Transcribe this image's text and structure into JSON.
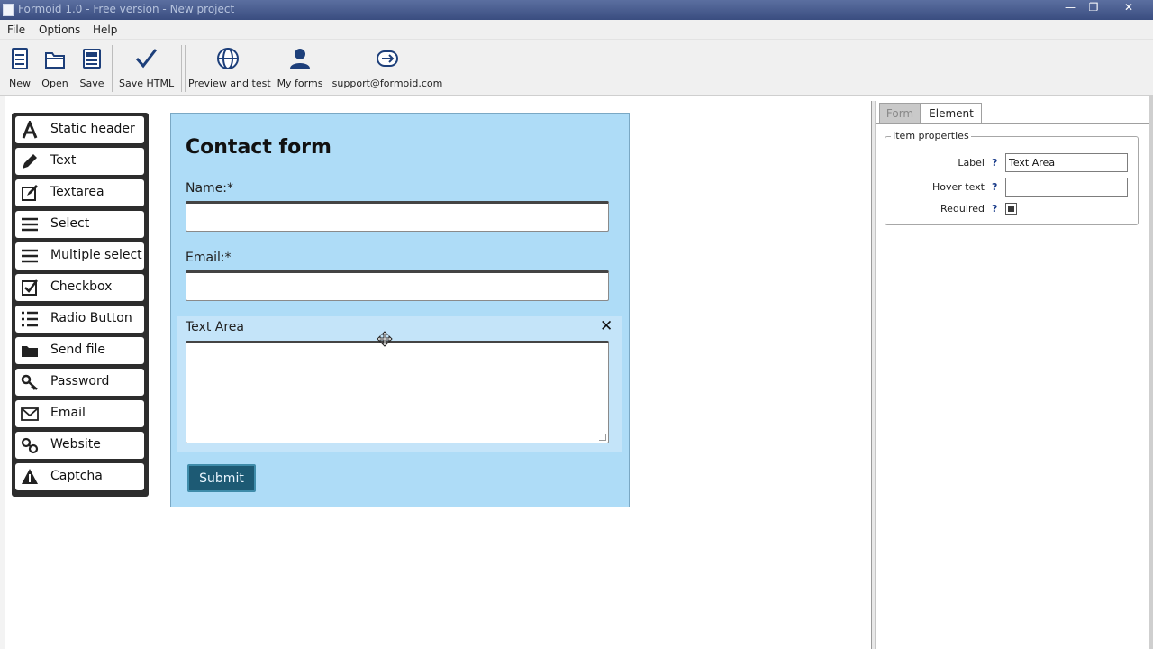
{
  "window": {
    "title": "Formoid 1.0 - Free version - New project",
    "controls": [
      "minimize-icon",
      "restore-icon",
      "close-icon"
    ]
  },
  "menu": {
    "items": [
      "File",
      "Options",
      "Help"
    ]
  },
  "toolbar": {
    "buttons": [
      {
        "label": "New",
        "icon": "new-document-icon"
      },
      {
        "label": "Open",
        "icon": "folder-open-icon"
      },
      {
        "label": "Save",
        "icon": "save-icon"
      },
      {
        "label": "Save HTML",
        "icon": "checkmark-icon"
      },
      {
        "label": "Preview and test",
        "icon": "globe-icon"
      },
      {
        "label": "My forms",
        "icon": "user-icon"
      },
      {
        "label": "support@formoid.com",
        "icon": "support-icon"
      }
    ]
  },
  "palette": {
    "items": [
      {
        "label": "Static header",
        "icon": "letter-a-icon"
      },
      {
        "label": "Text",
        "icon": "pencil-icon"
      },
      {
        "label": "Textarea",
        "icon": "edit-box-icon"
      },
      {
        "label": "Select",
        "icon": "lines-icon"
      },
      {
        "label": "Multiple select",
        "icon": "lines-icon"
      },
      {
        "label": "Checkbox",
        "icon": "checkbox-icon"
      },
      {
        "label": "Radio Button",
        "icon": "list-icon"
      },
      {
        "label": "Send file",
        "icon": "folder-icon"
      },
      {
        "label": "Password",
        "icon": "key-icon"
      },
      {
        "label": "Email",
        "icon": "envelope-icon"
      },
      {
        "label": "Website",
        "icon": "link-icon"
      },
      {
        "label": "Captcha",
        "icon": "warning-icon"
      }
    ]
  },
  "form": {
    "title": "Contact form",
    "fields": [
      {
        "label": "Name:*",
        "value": ""
      },
      {
        "label": "Email:*",
        "value": ""
      }
    ],
    "textarea": {
      "label": "Text Area",
      "value": ""
    },
    "submit_label": "Submit",
    "delete_glyph": "✕",
    "colors": {
      "background": "#aedcf7",
      "submit": "#1d5a74"
    }
  },
  "properties": {
    "tabs": [
      "Form",
      "Element"
    ],
    "active_tab": "Element",
    "group_title": "Item properties",
    "rows": [
      {
        "label": "Label",
        "help": "?",
        "value": "Text Area"
      },
      {
        "label": "Hover text",
        "help": "?",
        "value": ""
      },
      {
        "label": "Required",
        "help": "?",
        "checked": true
      }
    ]
  }
}
